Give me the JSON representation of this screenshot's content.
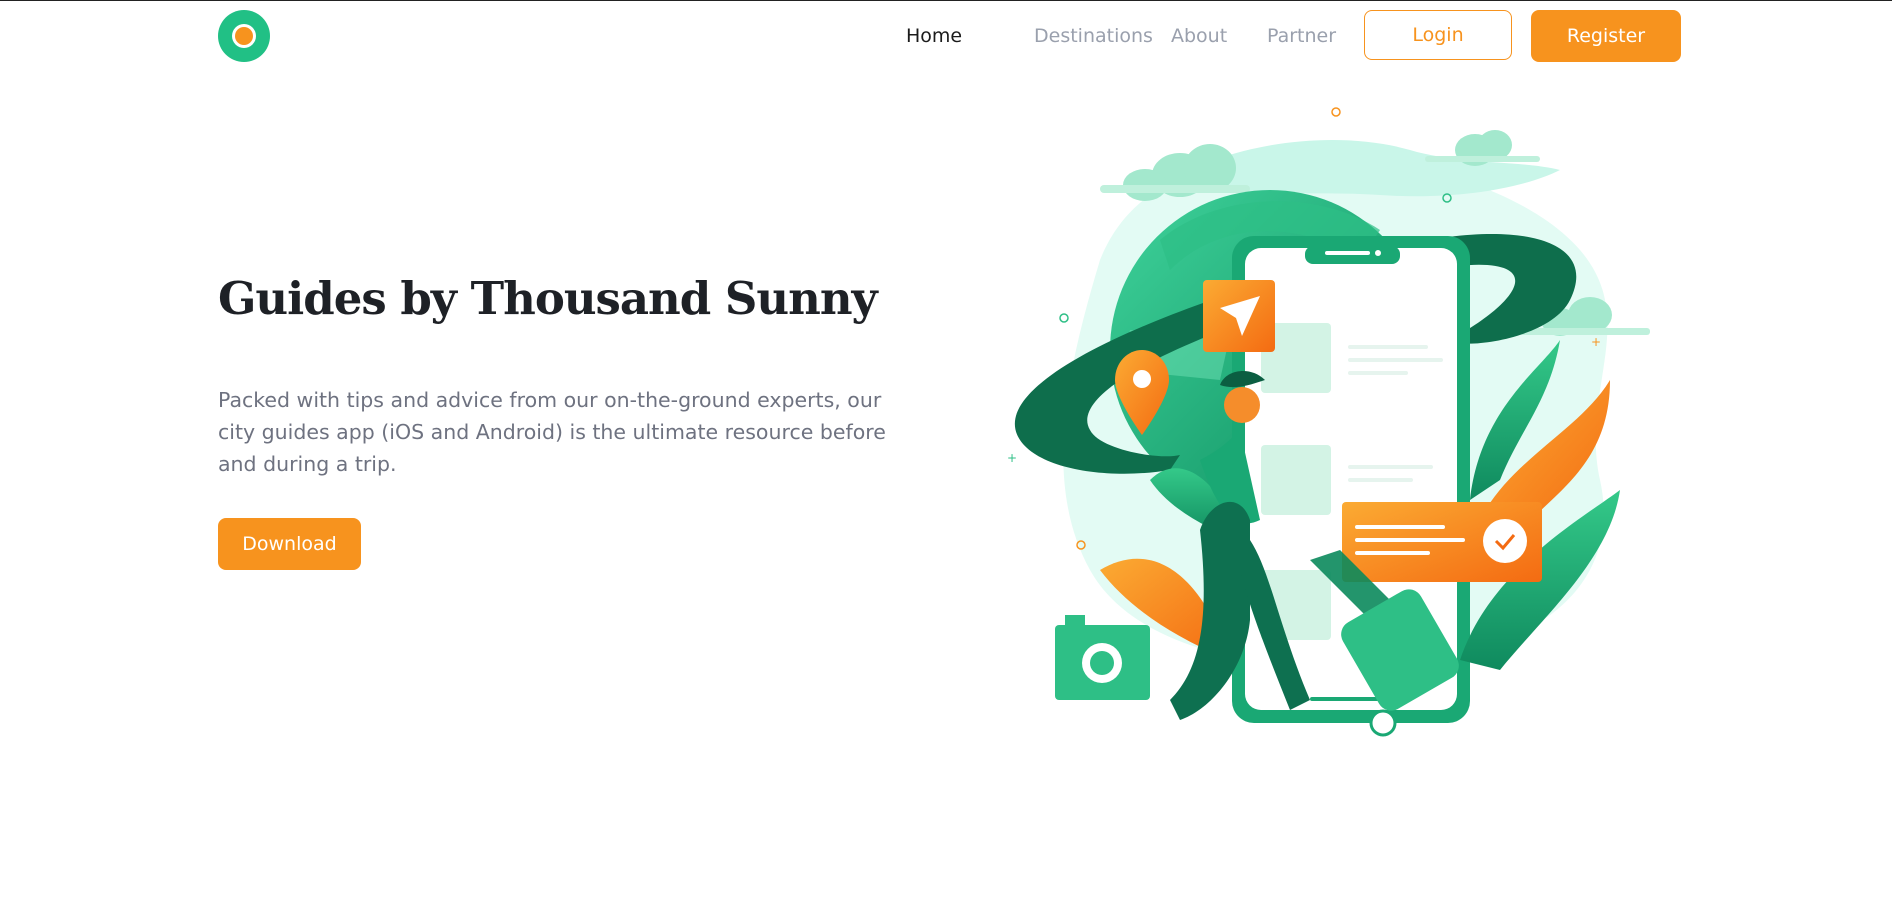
{
  "nav": {
    "items": [
      {
        "label": "Home",
        "active": true
      },
      {
        "label": "Destinations",
        "active": false
      },
      {
        "label": "About",
        "active": false
      },
      {
        "label": "Partner",
        "active": false
      }
    ],
    "login_label": "Login",
    "register_label": "Register"
  },
  "hero": {
    "title": "Guides by Thousand Sunny",
    "description": "Packed with tips and advice from our on-the-ground experts, our city guides app (iOS and Android) is the ultimate resource before and during a trip.",
    "download_label": "Download"
  },
  "colors": {
    "accent": "#f7931e",
    "brand_green": "#21c085",
    "text_dark": "#1e2126",
    "text_muted": "#6e7280"
  },
  "icons": [
    "logo-icon",
    "paper-plane-icon",
    "location-pin-icon",
    "check-icon",
    "camera-icon"
  ]
}
